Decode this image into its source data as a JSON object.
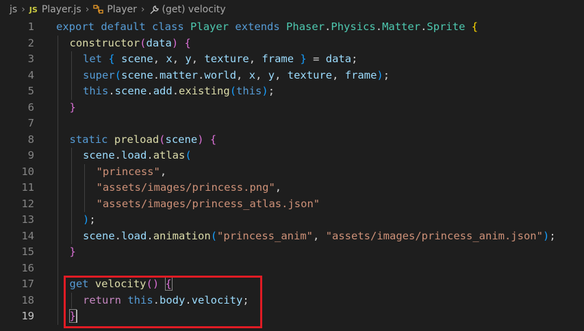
{
  "breadcrumb": {
    "folder": "js",
    "file": "Player.js",
    "file_icon": "JS",
    "class_symbol": "Player",
    "member_symbol": "(get) velocity",
    "icons": [
      "chevron-right-icon",
      "js-file-icon",
      "class-symbol-icon",
      "property-wrench-icon"
    ]
  },
  "colors": {
    "keyword": "#569cd6",
    "control": "#c586c0",
    "class": "#4ec9b0",
    "variable": "#9cdcfe",
    "function": "#dcdcaa",
    "string": "#ce9178",
    "bracket1": "#ffd700",
    "bracket2": "#da70d6",
    "bracket3": "#179fff",
    "highlight_box": "#e01b24"
  },
  "editor": {
    "active_line": 19,
    "lines": [
      {
        "n": "1",
        "tokens": [
          [
            "kw",
            "export"
          ],
          [
            "punc",
            " "
          ],
          [
            "kw",
            "default"
          ],
          [
            "punc",
            " "
          ],
          [
            "kw",
            "class"
          ],
          [
            "punc",
            " "
          ],
          [
            "cls",
            "Player"
          ],
          [
            "punc",
            " "
          ],
          [
            "kw",
            "extends"
          ],
          [
            "punc",
            " "
          ],
          [
            "cls",
            "Phaser"
          ],
          [
            "punc",
            "."
          ],
          [
            "cls",
            "Physics"
          ],
          [
            "punc",
            "."
          ],
          [
            "cls",
            "Matter"
          ],
          [
            "punc",
            "."
          ],
          [
            "cls",
            "Sprite"
          ],
          [
            "punc",
            " "
          ],
          [
            "p1",
            "{"
          ]
        ]
      },
      {
        "n": "2",
        "tokens": [
          [
            "fn",
            "constructor"
          ],
          [
            "p2",
            "("
          ],
          [
            "var",
            "data"
          ],
          [
            "p2",
            ")"
          ],
          [
            "punc",
            " "
          ],
          [
            "p2",
            "{"
          ]
        ]
      },
      {
        "n": "3",
        "tokens": [
          [
            "kw",
            "let"
          ],
          [
            "punc",
            " "
          ],
          [
            "p3",
            "{"
          ],
          [
            "punc",
            " "
          ],
          [
            "var",
            "scene"
          ],
          [
            "punc",
            ", "
          ],
          [
            "var",
            "x"
          ],
          [
            "punc",
            ", "
          ],
          [
            "var",
            "y"
          ],
          [
            "punc",
            ", "
          ],
          [
            "var",
            "texture"
          ],
          [
            "punc",
            ", "
          ],
          [
            "var",
            "frame"
          ],
          [
            "punc",
            " "
          ],
          [
            "p3",
            "}"
          ],
          [
            "punc",
            " = "
          ],
          [
            "var",
            "data"
          ],
          [
            "punc",
            ";"
          ]
        ]
      },
      {
        "n": "4",
        "tokens": [
          [
            "kw",
            "super"
          ],
          [
            "p3",
            "("
          ],
          [
            "var",
            "scene"
          ],
          [
            "punc",
            "."
          ],
          [
            "var",
            "matter"
          ],
          [
            "punc",
            "."
          ],
          [
            "var",
            "world"
          ],
          [
            "punc",
            ", "
          ],
          [
            "var",
            "x"
          ],
          [
            "punc",
            ", "
          ],
          [
            "var",
            "y"
          ],
          [
            "punc",
            ", "
          ],
          [
            "var",
            "texture"
          ],
          [
            "punc",
            ", "
          ],
          [
            "var",
            "frame"
          ],
          [
            "p3",
            ")"
          ],
          [
            "punc",
            ";"
          ]
        ]
      },
      {
        "n": "5",
        "tokens": [
          [
            "kw",
            "this"
          ],
          [
            "punc",
            "."
          ],
          [
            "var",
            "scene"
          ],
          [
            "punc",
            "."
          ],
          [
            "var",
            "add"
          ],
          [
            "punc",
            "."
          ],
          [
            "fn",
            "existing"
          ],
          [
            "p3",
            "("
          ],
          [
            "kw",
            "this"
          ],
          [
            "p3",
            ")"
          ],
          [
            "punc",
            ";"
          ]
        ]
      },
      {
        "n": "6",
        "tokens": [
          [
            "p2",
            "}"
          ]
        ]
      },
      {
        "n": "7",
        "tokens": []
      },
      {
        "n": "8",
        "tokens": [
          [
            "kw",
            "static"
          ],
          [
            "punc",
            " "
          ],
          [
            "fn",
            "preload"
          ],
          [
            "p2",
            "("
          ],
          [
            "var",
            "scene"
          ],
          [
            "p2",
            ")"
          ],
          [
            "punc",
            " "
          ],
          [
            "p2",
            "{"
          ]
        ]
      },
      {
        "n": "9",
        "tokens": [
          [
            "var",
            "scene"
          ],
          [
            "punc",
            "."
          ],
          [
            "var",
            "load"
          ],
          [
            "punc",
            "."
          ],
          [
            "fn",
            "atlas"
          ],
          [
            "p3",
            "("
          ]
        ]
      },
      {
        "n": "10",
        "tokens": [
          [
            "str",
            "\"princess\""
          ],
          [
            "punc",
            ","
          ]
        ]
      },
      {
        "n": "11",
        "tokens": [
          [
            "str",
            "\"assets/images/princess.png\""
          ],
          [
            "punc",
            ","
          ]
        ]
      },
      {
        "n": "12",
        "tokens": [
          [
            "str",
            "\"assets/images/princess_atlas.json\""
          ]
        ]
      },
      {
        "n": "13",
        "tokens": [
          [
            "p3",
            ")"
          ],
          [
            "punc",
            ";"
          ]
        ]
      },
      {
        "n": "14",
        "tokens": [
          [
            "var",
            "scene"
          ],
          [
            "punc",
            "."
          ],
          [
            "var",
            "load"
          ],
          [
            "punc",
            "."
          ],
          [
            "fn",
            "animation"
          ],
          [
            "p3",
            "("
          ],
          [
            "str",
            "\"princess_anim\""
          ],
          [
            "punc",
            ", "
          ],
          [
            "str",
            "\"assets/images/princess_anim.json\""
          ],
          [
            "p3",
            ")"
          ],
          [
            "punc",
            ";"
          ]
        ]
      },
      {
        "n": "15",
        "tokens": [
          [
            "p2",
            "}"
          ]
        ]
      },
      {
        "n": "16",
        "tokens": []
      },
      {
        "n": "17",
        "tokens": [
          [
            "kw",
            "get"
          ],
          [
            "punc",
            " "
          ],
          [
            "fn",
            "velocity"
          ],
          [
            "p2",
            "()"
          ],
          [
            "punc",
            " "
          ],
          [
            "p2",
            "{"
          ]
        ]
      },
      {
        "n": "18",
        "tokens": [
          [
            "ctrl",
            "return"
          ],
          [
            "punc",
            " "
          ],
          [
            "kw",
            "this"
          ],
          [
            "punc",
            "."
          ],
          [
            "var",
            "body"
          ],
          [
            "punc",
            "."
          ],
          [
            "var",
            "velocity"
          ],
          [
            "punc",
            ";"
          ]
        ]
      },
      {
        "n": "19",
        "tokens": [
          [
            "p2",
            "}"
          ]
        ]
      }
    ]
  }
}
